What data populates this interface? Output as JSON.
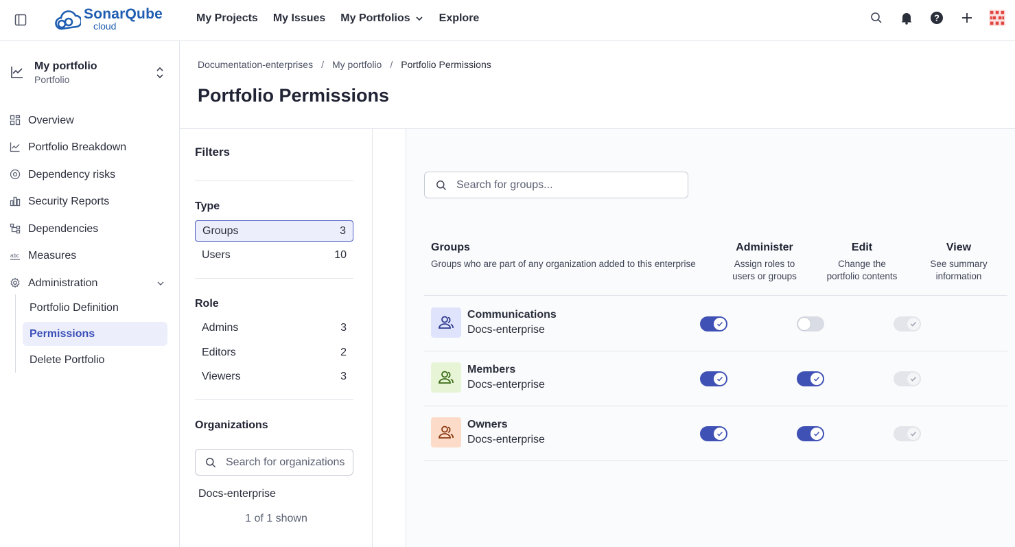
{
  "app": {
    "logo_main": "SonarQube",
    "logo_sub": "cloud"
  },
  "nav": {
    "items": [
      "My Projects",
      "My Issues",
      "My Portfolios",
      "Explore"
    ]
  },
  "portfolio": {
    "name": "My portfolio",
    "type": "Portfolio"
  },
  "sidebar": {
    "items": [
      {
        "label": "Overview",
        "icon": "grid-icon"
      },
      {
        "label": "Portfolio Breakdown",
        "icon": "chart-icon"
      },
      {
        "label": "Dependency risks",
        "icon": "shield-icon"
      },
      {
        "label": "Security Reports",
        "icon": "bars-icon"
      },
      {
        "label": "Dependencies",
        "icon": "tree-icon"
      },
      {
        "label": "Measures",
        "icon": "measures-icon"
      },
      {
        "label": "Administration",
        "icon": "gear-icon"
      }
    ],
    "admin_sub": [
      "Portfolio Definition",
      "Permissions",
      "Delete Portfolio"
    ]
  },
  "breadcrumb": [
    "Documentation-enterprises",
    "My portfolio",
    "Portfolio Permissions"
  ],
  "page_title": "Portfolio Permissions",
  "filters": {
    "title": "Filters",
    "type_label": "Type",
    "types": [
      {
        "label": "Groups",
        "count": "3"
      },
      {
        "label": "Users",
        "count": "10"
      }
    ],
    "role_label": "Role",
    "roles": [
      {
        "label": "Admins",
        "count": "3"
      },
      {
        "label": "Editors",
        "count": "2"
      },
      {
        "label": "Viewers",
        "count": "3"
      }
    ],
    "org_label": "Organizations",
    "org_placeholder": "Search for organizations",
    "orgs": [
      "Docs-enterprise"
    ],
    "shown": "1 of 1 shown"
  },
  "groups_search_placeholder": "Search for groups...",
  "table": {
    "groups_title": "Groups",
    "groups_desc": "Groups who are part of any organization added to this enterprise",
    "cols": [
      {
        "title": "Administer",
        "desc1": "Assign roles to",
        "desc2": "users or groups"
      },
      {
        "title": "Edit",
        "desc1": "Change the",
        "desc2": "portfolio contents"
      },
      {
        "title": "View",
        "desc1": "See summary",
        "desc2": "information"
      }
    ],
    "rows": [
      {
        "name": "Communications",
        "org": "Docs-enterprise",
        "color": "#dfe3fb",
        "icon_color": "#2f3a8f",
        "administer": true,
        "edit": false,
        "view": true
      },
      {
        "name": "Members",
        "org": "Docs-enterprise",
        "color": "#e7f5d6",
        "icon_color": "#3b6b16",
        "administer": true,
        "edit": true,
        "view": true
      },
      {
        "name": "Owners",
        "org": "Docs-enterprise",
        "color": "#fcdcc8",
        "icon_color": "#8a3a12",
        "administer": true,
        "edit": true,
        "view": true
      }
    ]
  },
  "colors": {
    "accent": "#3f51b5",
    "brand": "#1e5db0"
  }
}
